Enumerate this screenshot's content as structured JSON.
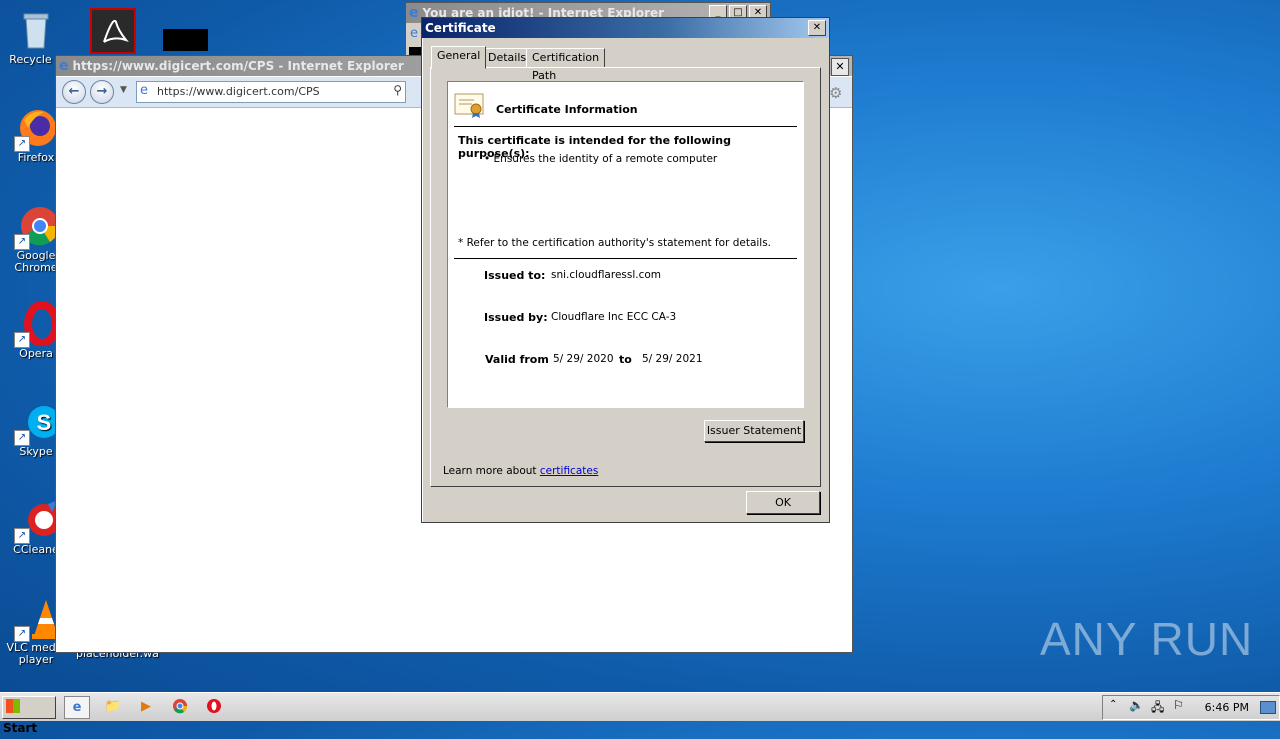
{
  "desktop_icons": [
    {
      "name": "recycle-bin",
      "label": "Recycle B"
    },
    {
      "name": "firefox",
      "label": "Firefox"
    },
    {
      "name": "chrome",
      "label": "Google Chrome"
    },
    {
      "name": "opera",
      "label": "Opera"
    },
    {
      "name": "skype",
      "label": "Skype"
    },
    {
      "name": "ccleaner",
      "label": "CCleane"
    },
    {
      "name": "vlc",
      "label": "VLC media player"
    },
    {
      "name": "placeholder",
      "label": "placeholder.wa"
    }
  ],
  "ie_back": {
    "title": "You are an idiot! - Internet Explorer"
  },
  "ie_main": {
    "title": "https://www.digicert.com/CPS - Internet Explorer",
    "address": "https://www.digicert.com/CPS"
  },
  "cert": {
    "title": "Certificate",
    "tabs": [
      "General",
      "Details",
      "Certification Path"
    ],
    "header": "Certificate Information",
    "purpose_heading": "This certificate is intended for the following purpose(s):",
    "purpose_item": "• Ensures the identity of a remote computer",
    "refer_note": "* Refer to the certification authority's statement for details.",
    "issued_to_label": "Issued to:",
    "issued_to": "sni.cloudflaressl.com",
    "issued_by_label": "Issued by:",
    "issued_by": "Cloudflare Inc ECC CA-3",
    "valid_from_label": "Valid from",
    "valid_from": "5/ 29/ 2020",
    "to_label": "to",
    "valid_to": "5/ 29/ 2021",
    "issuer_statement_button": "Issuer Statement",
    "learn_more_prefix": "Learn more about ",
    "learn_more_link": "certificates",
    "ok_button": "OK"
  },
  "taskbar": {
    "start_label": "Start",
    "clock": "6:46 PM"
  },
  "watermark": "ANY RUN"
}
